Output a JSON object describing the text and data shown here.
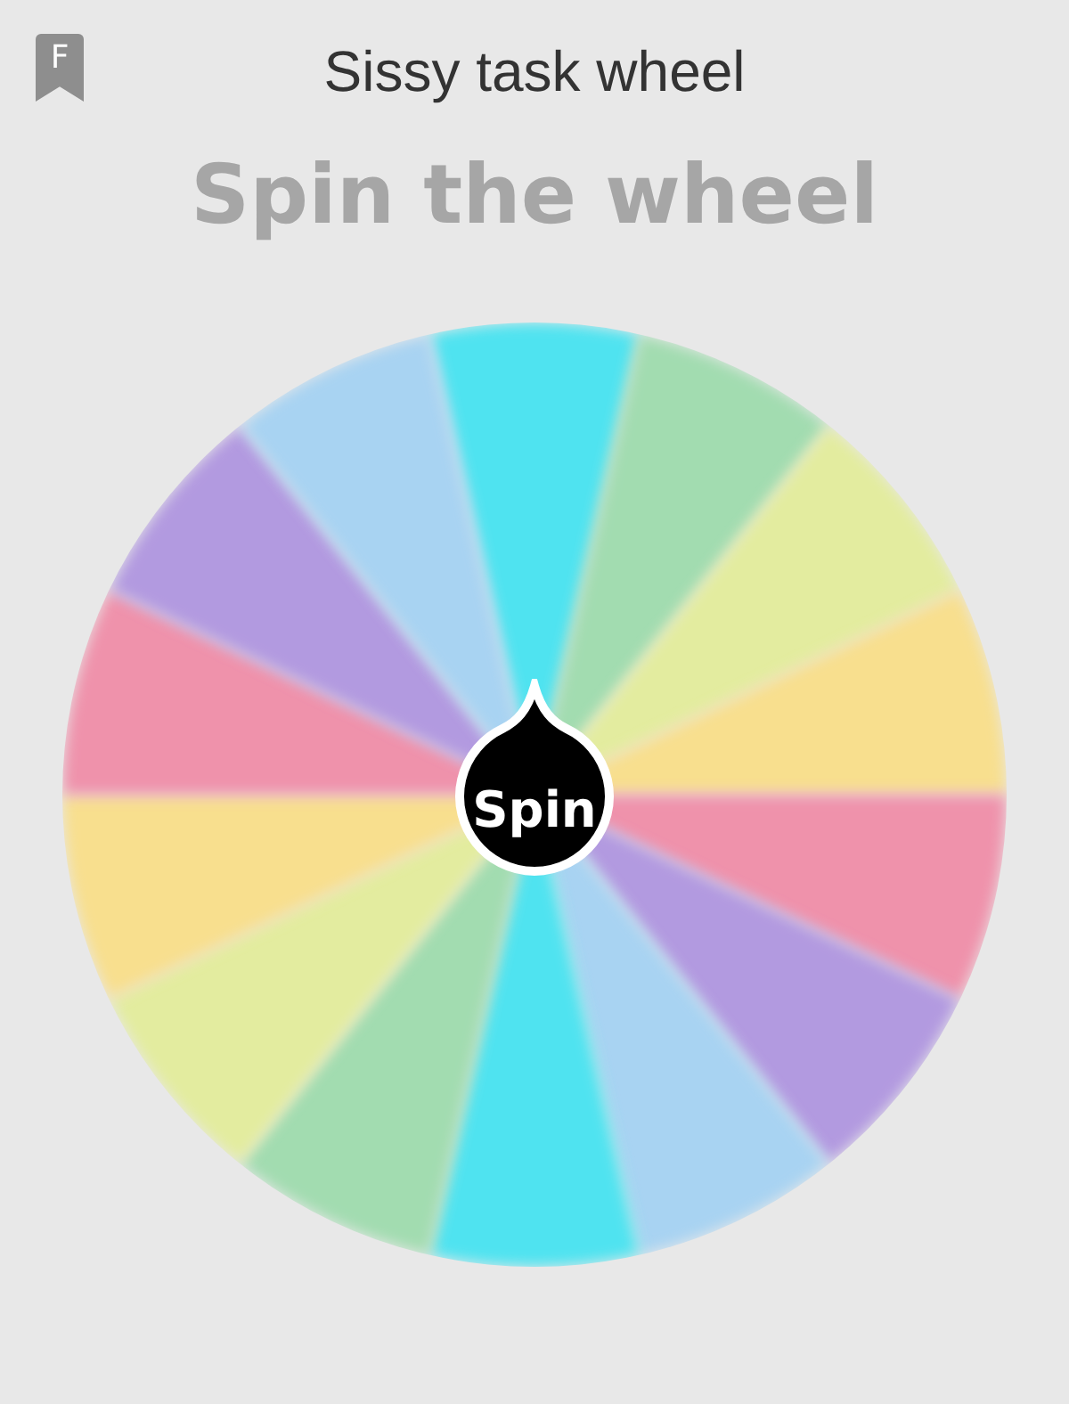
{
  "header": {
    "title": "Sissy task wheel",
    "badge": "F"
  },
  "heading": "Spin the wheel",
  "wheel": {
    "button": "Spin",
    "segments": [
      {
        "color": "#4fe3f0"
      },
      {
        "color": "#a2dcb0"
      },
      {
        "color": "#e3ec9f"
      },
      {
        "color": "#f8df8e"
      },
      {
        "color": "#ef92ab"
      },
      {
        "color": "#b29ae0"
      },
      {
        "color": "#a8d3f2"
      },
      {
        "color": "#4fe3f0"
      },
      {
        "color": "#a2dcb0"
      },
      {
        "color": "#e3ec9f"
      },
      {
        "color": "#f8df8e"
      },
      {
        "color": "#ef92ab"
      },
      {
        "color": "#b29ae0"
      },
      {
        "color": "#a8d3f2"
      }
    ]
  }
}
